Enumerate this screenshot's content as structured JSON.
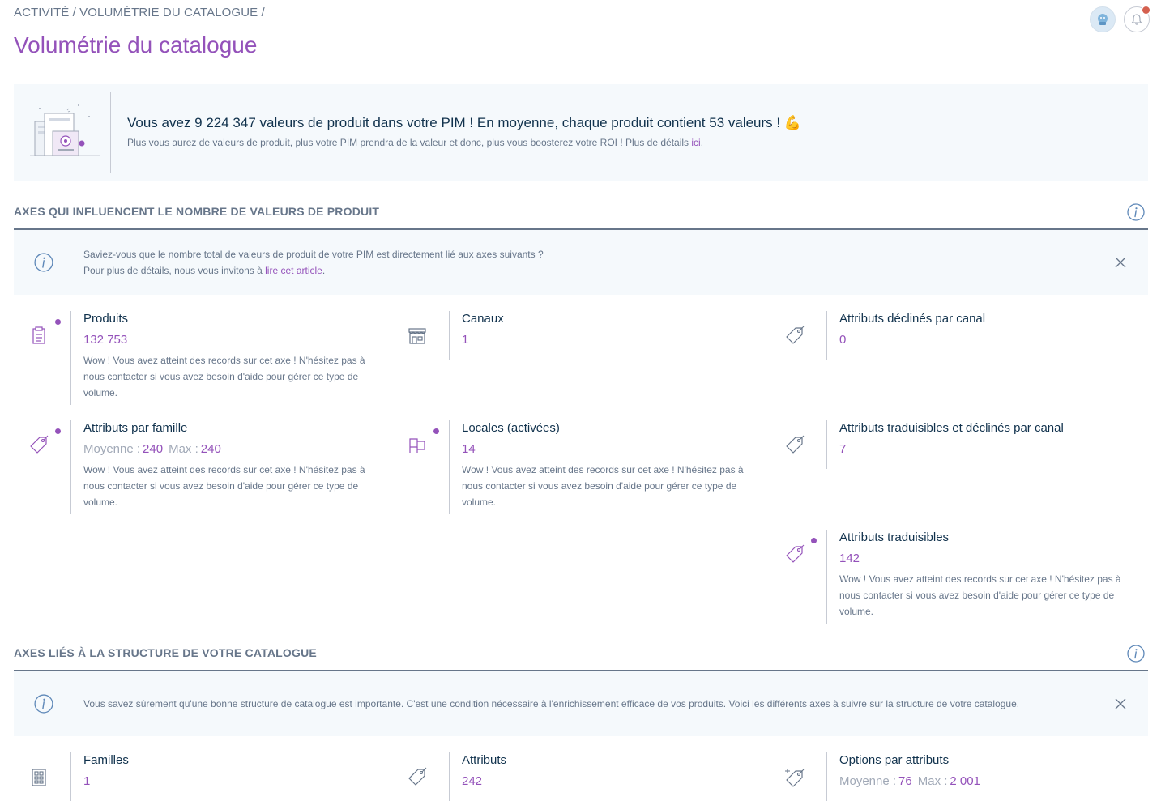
{
  "breadcrumb": {
    "item1": "ACTIVITÉ",
    "sep1": " / ",
    "item2": "VOLUMÉTRIE DU CATALOGUE",
    "sep2": " /"
  },
  "page_title": "Volumétrie du catalogue",
  "hero": {
    "main_text": "Vous avez 9 224 347 valeurs de produit dans votre PIM ! En moyenne, chaque produit contient 53 valeurs ! 💪",
    "sub_text": "Plus vous aurez de valeurs de produit, plus votre PIM prendra de la valeur et donc, plus vous boosterez votre ROI ! Plus de détails ",
    "sub_link": "ici",
    "sub_end": "."
  },
  "section1": {
    "title": "AXES QUI INFLUENCENT LE NOMBRE DE VALEURS DE PRODUIT",
    "helper_line1": "Saviez-vous que le nombre total de valeurs de produit de votre PIM est directement lié aux axes suivants ?",
    "helper_line2_prefix": "Pour plus de détails, nous vous invitons à ",
    "helper_link": "lire cet article",
    "helper_line2_suffix": "."
  },
  "axes_values": [
    {
      "title": "Produits",
      "value": "132 753",
      "icon": "clipboard-icon",
      "message": "Wow ! Vous avez atteint des records sur cet axe ! N'hésitez pas à nous contacter si vous avez besoin d'aide pour gérer ce type de volume."
    },
    {
      "title": "Canaux",
      "value": "1",
      "icon": "store-icon"
    },
    {
      "title": "Attributs déclinés par canal",
      "value": "0",
      "icon": "tag-icon"
    },
    {
      "title": "Attributs par famille",
      "avg_label": "Moyenne :",
      "avg": "240",
      "max_label": "Max :",
      "max": "240",
      "icon": "tag-icon",
      "message": "Wow ! Vous avez atteint des records sur cet axe ! N'hésitez pas à nous contacter si vous avez besoin d'aide pour gérer ce type de volume."
    },
    {
      "title": "Locales (activées)",
      "value": "14",
      "icon": "flags-icon",
      "message": "Wow ! Vous avez atteint des records sur cet axe ! N'hésitez pas à nous contacter si vous avez besoin d'aide pour gérer ce type de volume."
    },
    {
      "title": "Attributs traduisibles et déclinés par canal",
      "value": "7",
      "icon": "tag-icon"
    },
    {
      "title": "Attributs traduisibles",
      "value": "142",
      "icon": "tag-icon",
      "message": "Wow ! Vous avez atteint des records sur cet axe ! N'hésitez pas à nous contacter si vous avez besoin d'aide pour gérer ce type de volume."
    }
  ],
  "section2": {
    "title": "AXES LIÉS À LA STRUCTURE DE VOTRE CATALOGUE",
    "helper_text": "Vous savez sûrement qu'une bonne structure de catalogue est importante. C'est une condition nécessaire à l'enrichissement efficace de vos produits. Voici les différents axes à suivre sur la structure de votre catalogue."
  },
  "axes_structure": [
    {
      "title": "Familles",
      "value": "1",
      "icon": "family-grid-icon"
    },
    {
      "title": "Attributs",
      "value": "242",
      "icon": "tag-icon"
    },
    {
      "title": "Options par attributs",
      "avg_label": "Moyenne :",
      "avg": "76",
      "max_label": "Max :",
      "max": "2 001",
      "icon": "tag-sparkle-icon"
    }
  ],
  "colors": {
    "brand_purple": "#9452ba",
    "text_dark": "#11324d",
    "text_grey": "#67768a",
    "helper_bg": "#f5f9fc",
    "notification_red": "#d4604f"
  }
}
